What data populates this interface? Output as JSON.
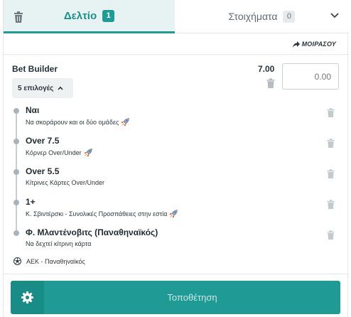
{
  "tabs": {
    "slip": {
      "label": "Δελτίο",
      "count": "1"
    },
    "bets": {
      "label": "Στοιχήματα",
      "count": "0"
    }
  },
  "share": {
    "label": "ΜΟΙΡΑΣΟΥ"
  },
  "bet_builder": {
    "title": "Bet Builder",
    "odds": "7.00",
    "stake_placeholder": "0.00",
    "picks_toggle": "5 επιλογές"
  },
  "selections": [
    {
      "title": "Ναι",
      "market": "Να σκοράρουν και οι δύο ομάδες",
      "boost": true
    },
    {
      "title": "Over 7.5",
      "market": "Κόρνερ Over/Under",
      "boost": true
    },
    {
      "title": "Over 5.5",
      "market": "Κίτρινες Κάρτες Over/Under",
      "boost": false
    },
    {
      "title": "1+",
      "market": "Κ. Σβιντέρσκι - Συνολικές Προσπάθειες στην εστία",
      "boost": true
    },
    {
      "title": "Φ. Μλαντένοβιτς (Παναθηναϊκός)",
      "market": "Να δεχτεί κίτρινη κάρτα",
      "boost": false
    }
  ],
  "match": {
    "label": "ΑΕΚ -  Παναθηναϊκός",
    "icon": "football-icon"
  },
  "footer": {
    "place_label": "Τοποθέτηση",
    "settings_icon": "gear-icon"
  },
  "colors": {
    "accent": "#1f9b96",
    "accent_dark": "#1a8c87",
    "tab_active_bg": "#e6f3f2"
  }
}
